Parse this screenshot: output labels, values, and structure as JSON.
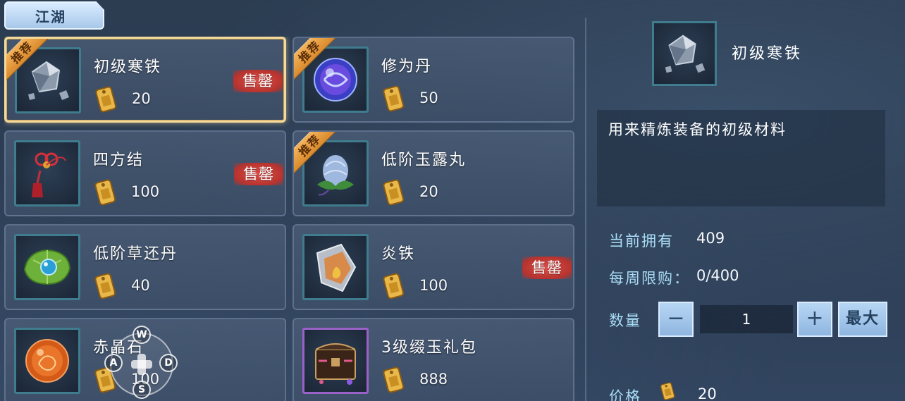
{
  "category_tab": {
    "label": "江湖"
  },
  "items": [
    {
      "name": "初级寒铁",
      "price": "20",
      "recommend": true,
      "soldout": true,
      "selected": true,
      "icon": "cold-iron-ore-icon"
    },
    {
      "name": "修为丹",
      "price": "50",
      "recommend": true,
      "soldout": false,
      "selected": false,
      "icon": "cultivation-pill-icon"
    },
    {
      "name": "四方结",
      "price": "100",
      "recommend": false,
      "soldout": true,
      "selected": false,
      "icon": "red-knot-tassel-icon"
    },
    {
      "name": "低阶玉露丸",
      "price": "20",
      "recommend": true,
      "soldout": false,
      "selected": false,
      "icon": "jade-dew-pill-icon"
    },
    {
      "name": "低阶草还丹",
      "price": "40",
      "recommend": false,
      "soldout": false,
      "selected": false,
      "icon": "herb-leaf-pill-icon"
    },
    {
      "name": "炎铁",
      "price": "100",
      "recommend": false,
      "soldout": true,
      "selected": false,
      "icon": "flame-iron-icon"
    },
    {
      "name": "赤晶石",
      "price": "100",
      "recommend": false,
      "soldout": false,
      "selected": false,
      "icon": "red-crystal-icon"
    },
    {
      "name": "3级缀玉礼包",
      "price": "888",
      "recommend": false,
      "soldout": false,
      "selected": false,
      "icon": "gift-chest-icon"
    }
  ],
  "badges": {
    "recommend": "推荐",
    "soldout": "售罄"
  },
  "joystick": {
    "up": "W",
    "left": "A",
    "down": "S",
    "right": "D"
  },
  "detail": {
    "name": "初级寒铁",
    "description": "用来精炼装备的初级材料",
    "owned_label": "当前拥有",
    "owned_value": "409",
    "limit_label": "每周限购：",
    "limit_value": "0/400",
    "quantity_label": "数量",
    "quantity_value": "1",
    "minus_label": "−",
    "plus_label": "+",
    "max_label": "最大",
    "price_label": "价格",
    "price_value": "20"
  },
  "colors": {
    "selected_border": "#f4d99a",
    "recommend_ribbon": "#e09a3d",
    "soldout_badge": "#c63d38",
    "stat_label": "#a9dcf5"
  }
}
